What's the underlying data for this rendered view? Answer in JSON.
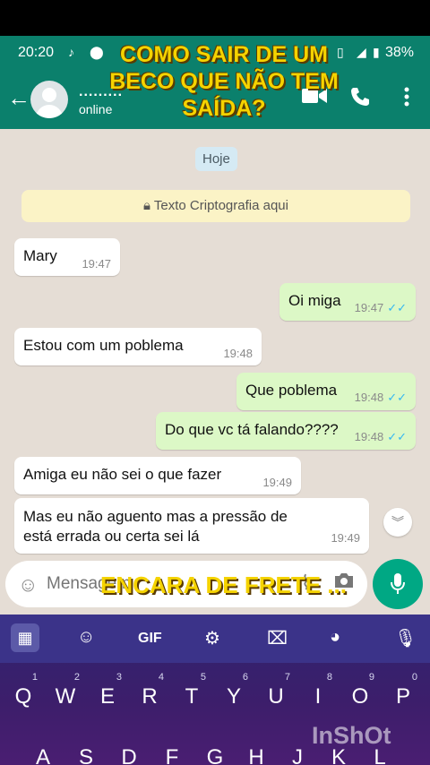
{
  "overlay": {
    "title": "COMO SAIR DE UM BECO QUE NÃO TEM SAÍDA?",
    "bottom_caption": "ENCARA DE FRETE ...",
    "watermark": "InShOt"
  },
  "status_bar": {
    "time": "20:20",
    "battery": "38%"
  },
  "header": {
    "contact_name": ".........",
    "contact_status": "online",
    "icons": [
      "back-arrow-icon",
      "video-call-icon",
      "phone-icon",
      "more-options-icon"
    ]
  },
  "chat": {
    "day_label": "Hoje",
    "encryption_notice": "Texto Criptografia aqui",
    "messages": [
      {
        "direction": "in",
        "text": "Mary",
        "time": "19:47"
      },
      {
        "direction": "out",
        "text": "Oi miga",
        "time": "19:47",
        "ticks": "✓✓"
      },
      {
        "direction": "in",
        "text": "Estou com um poblema",
        "time": "19:48"
      },
      {
        "direction": "out",
        "text": "Que poblema",
        "time": "19:48",
        "ticks": "✓✓"
      },
      {
        "direction": "out",
        "text": "Do que vc tá falando????",
        "time": "19:48",
        "ticks": "✓✓"
      },
      {
        "direction": "in",
        "text": "Amiga eu não sei o que fazer",
        "time": "19:49"
      },
      {
        "direction": "in",
        "text": "Mas eu não aguento mas a pressão de está errada ou certa sei lá",
        "time": "19:49"
      }
    ]
  },
  "composer": {
    "placeholder": "Mensagem"
  },
  "keyboard": {
    "toolbar": [
      "grid",
      "sticker",
      "GIF",
      "settings",
      "translate",
      "theme",
      "mic"
    ],
    "gif_label": "GIF",
    "row1": [
      "Q",
      "W",
      "E",
      "R",
      "T",
      "Y",
      "U",
      "I",
      "O",
      "P"
    ],
    "row1_hints": [
      "1",
      "2",
      "3",
      "4",
      "5",
      "6",
      "7",
      "8",
      "9",
      "0"
    ],
    "row2": [
      "A",
      "S",
      "D",
      "F",
      "G",
      "H",
      "J",
      "K",
      "L"
    ]
  }
}
